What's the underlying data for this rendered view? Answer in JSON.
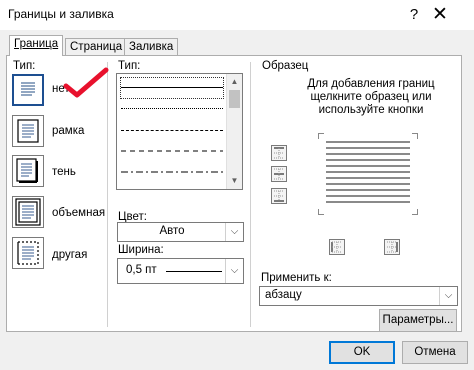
{
  "window": {
    "title": "Границы и заливка",
    "help": "?",
    "close": "✕"
  },
  "tabs": [
    {
      "label": "Граница",
      "active": true
    },
    {
      "label": "Страница",
      "active": false
    },
    {
      "label": "Заливка",
      "active": false
    }
  ],
  "setting": {
    "label": "Тип:",
    "items": [
      {
        "label": "нет",
        "selected": true
      },
      {
        "label": "рамка",
        "selected": false
      },
      {
        "label": "тень",
        "selected": false
      },
      {
        "label": "объемная",
        "selected": false
      },
      {
        "label": "другая",
        "selected": false
      }
    ]
  },
  "style": {
    "label": "Тип:",
    "line_styles": [
      "solid",
      "dotted",
      "dashed-small",
      "dashed",
      "dash-dot",
      "dash-dot-dot"
    ]
  },
  "color": {
    "label": "Цвет:",
    "value": "Авто"
  },
  "width": {
    "label": "Ширина:",
    "value": "0,5 пт"
  },
  "preview": {
    "label": "Образец",
    "instruction": "Для добавления границ щелкните образец или используйте кнопки"
  },
  "apply_to": {
    "label": "Применить к:",
    "value": "абзацу"
  },
  "buttons": {
    "options": "Параметры...",
    "ok": "OK",
    "cancel": "Отмена"
  },
  "colors": {
    "accent": "#0078d7",
    "checkmark": "#e8112d",
    "selected_border": "#1d4f91"
  }
}
